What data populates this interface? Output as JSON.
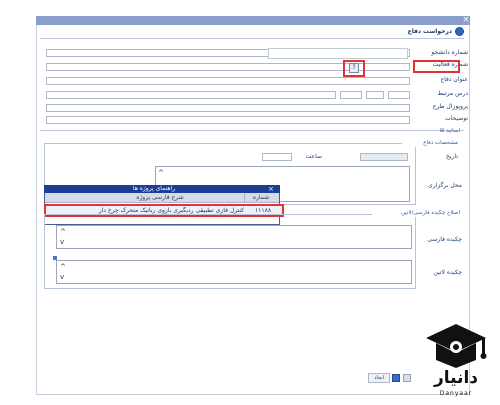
{
  "window": {
    "title": "درخواست دفاع",
    "close_glyph": "×"
  },
  "form": {
    "student_number_label": "شماره دانشجو",
    "activity_number_label": "شماره فعالیت",
    "activity_lookup_glyph": "?",
    "title_label": "عنوان دفاع",
    "related_course_label": "درس مرتبط",
    "proposal_label": "پروپوزال طرح",
    "description_label": "توضیحات"
  },
  "professors": {
    "toggle": "⊞",
    "label": "اساتید"
  },
  "defense_specs": {
    "section_title": "مشخصات دفاع",
    "date_label": "تاریخ",
    "time_label": "ساعت",
    "venue_label": "محل برگزاری"
  },
  "popup": {
    "title": "راهنمای پروژه ها",
    "close_glyph": "×",
    "col_number": "شماره",
    "col_description": "شرح فارسی پروژه",
    "rows": [
      {
        "number": "۱۱۱۸۸",
        "description": "کنترل فازی تطبیقی ردیگیری بازوی رباتیک متحرک چرخ دار"
      }
    ]
  },
  "abstract": {
    "section_title": "اصلاح چکیده فارسی/لاتین",
    "persian_label": "چکیده فارسی",
    "latin_label": "چکیده لاتین"
  },
  "footer": {
    "confirm_label": "ایجاد"
  },
  "watermark": {
    "brand": "دانیار",
    "sub": "Danyaar"
  },
  "colors": {
    "title_bar": "#8a9ecb",
    "highlight": "#e03434",
    "popup_header": "#1c3f96",
    "label_text": "#1b3f7a"
  }
}
